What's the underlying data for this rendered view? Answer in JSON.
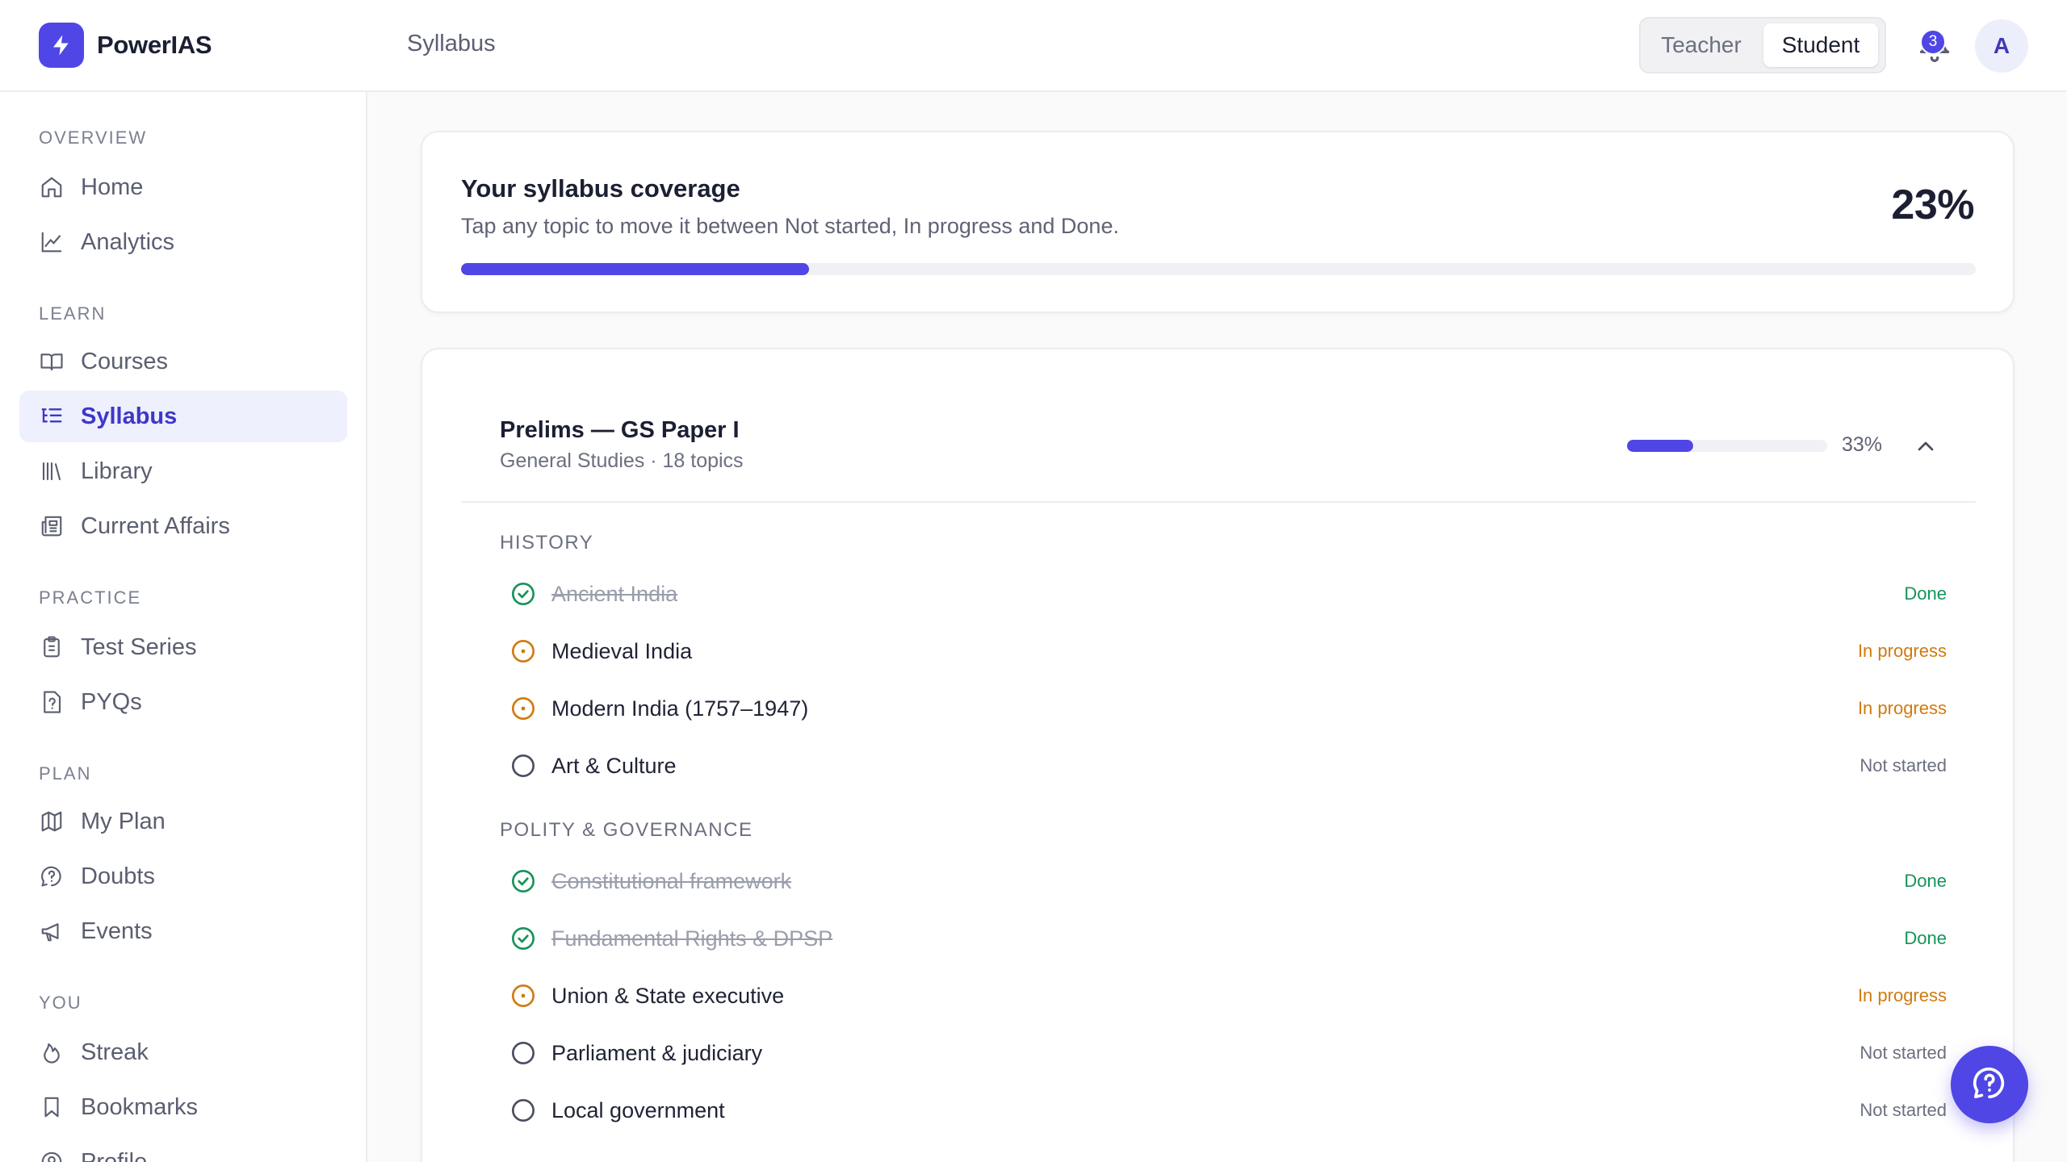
{
  "app": {
    "name": "PowerIAS",
    "page_title": "Syllabus"
  },
  "header": {
    "roles": [
      "Teacher",
      "Student"
    ],
    "active_role": "Student",
    "notification_count": "3",
    "avatar_initial": "A"
  },
  "sidebar": {
    "sections": [
      {
        "label": "OVERVIEW",
        "items": [
          {
            "label": "Home",
            "icon": "home-icon"
          },
          {
            "label": "Analytics",
            "icon": "chart-icon"
          }
        ]
      },
      {
        "label": "LEARN",
        "items": [
          {
            "label": "Courses",
            "icon": "book-open-icon"
          },
          {
            "label": "Syllabus",
            "icon": "list-tree-icon",
            "active": true
          },
          {
            "label": "Library",
            "icon": "library-icon"
          },
          {
            "label": "Current Affairs",
            "icon": "newspaper-icon"
          }
        ]
      },
      {
        "label": "PRACTICE",
        "items": [
          {
            "label": "Test Series",
            "icon": "clipboard-icon"
          },
          {
            "label": "PYQs",
            "icon": "file-question-icon"
          }
        ]
      },
      {
        "label": "PLAN",
        "items": [
          {
            "label": "My Plan",
            "icon": "map-icon"
          },
          {
            "label": "Doubts",
            "icon": "help-circle-icon"
          },
          {
            "label": "Events",
            "icon": "megaphone-icon"
          }
        ]
      },
      {
        "label": "YOU",
        "items": [
          {
            "label": "Streak",
            "icon": "flame-icon"
          },
          {
            "label": "Bookmarks",
            "icon": "bookmark-icon"
          },
          {
            "label": "Profile",
            "icon": "user-circle-icon"
          }
        ]
      }
    ]
  },
  "coverage": {
    "title": "Your syllabus coverage",
    "subtitle": "Tap any topic to move it between Not started, In progress and Done.",
    "percent_label": "23%",
    "progress": 0.23
  },
  "paper": {
    "title": "Prelims — GS Paper I",
    "subtitle": "General Studies · 18 topics",
    "percent_label": "33%",
    "progress": 0.33,
    "groups": [
      {
        "label": "HISTORY",
        "topics": [
          {
            "name": "Ancient India",
            "status": "Done"
          },
          {
            "name": "Medieval India",
            "status": "In progress"
          },
          {
            "name": "Modern India (1757–1947)",
            "status": "In progress"
          },
          {
            "name": "Art & Culture",
            "status": "Not started"
          }
        ]
      },
      {
        "label": "POLITY & GOVERNANCE",
        "topics": [
          {
            "name": "Constitutional framework",
            "status": "Done"
          },
          {
            "name": "Fundamental Rights & DPSP",
            "status": "Done"
          },
          {
            "name": "Union & State executive",
            "status": "In progress"
          },
          {
            "name": "Parliament & judiciary",
            "status": "Not started"
          },
          {
            "name": "Local government",
            "status": "Not started"
          }
        ]
      }
    ]
  },
  "colors": {
    "accent": "#4f46e5",
    "done": "#16935a",
    "in_progress": "#d27a0e",
    "not_started": "#6b6f80"
  }
}
